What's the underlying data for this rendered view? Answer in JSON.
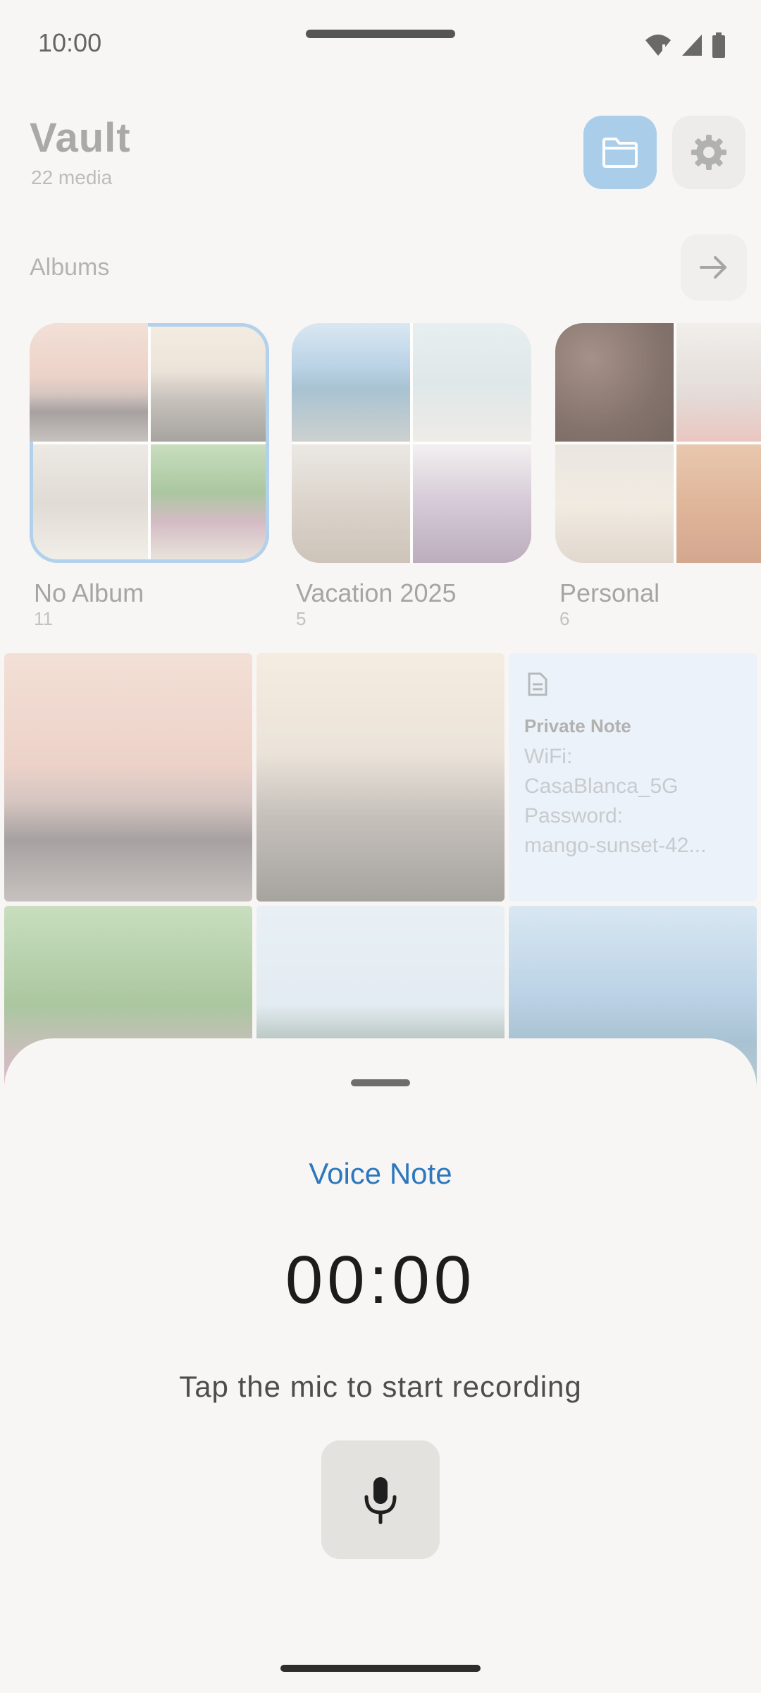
{
  "status": {
    "time": "10:00"
  },
  "header": {
    "title": "Vault",
    "subtitle": "22 media"
  },
  "albums_section": {
    "label": "Albums"
  },
  "albums": [
    {
      "name": "No Album",
      "count": "11"
    },
    {
      "name": "Vacation 2025",
      "count": "5"
    },
    {
      "name": "Personal",
      "count": "6"
    }
  ],
  "note": {
    "title": "Private Note",
    "body": "WiFi:\nCasaBlanca_5G\nPassword:\nmango-sunset-42..."
  },
  "sheet": {
    "title": "Voice Note",
    "timer": "00:00",
    "hint": "Tap the mic to start recording"
  },
  "colors": {
    "accent": "#2d78bd",
    "folder_button": "#90c0e6",
    "note_bg": "#e9f1fb"
  }
}
